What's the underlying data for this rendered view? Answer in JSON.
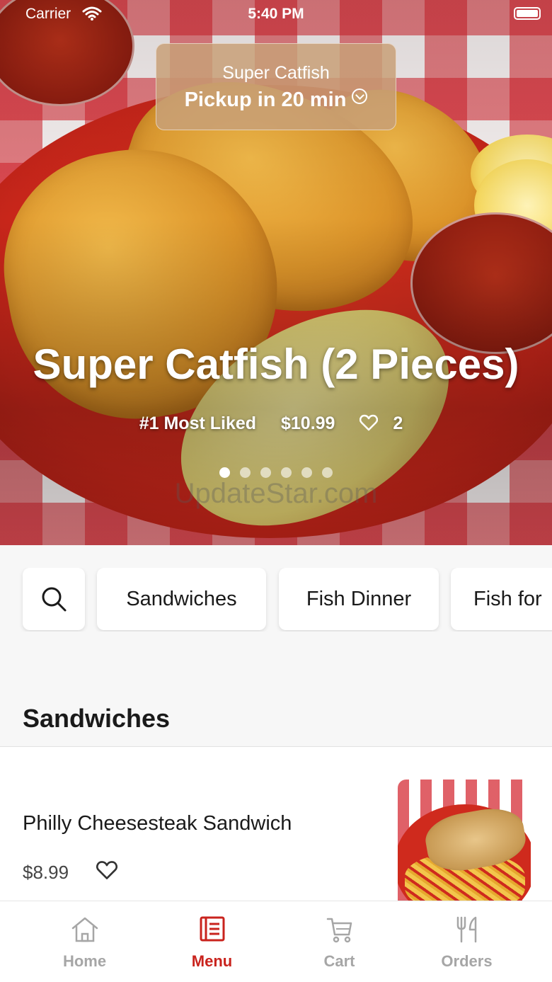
{
  "status_bar": {
    "carrier": "Carrier",
    "time": "5:40 PM"
  },
  "pickup": {
    "store": "Super Catfish",
    "time_text": "Pickup in 20 min"
  },
  "hero": {
    "title": "Super Catfish (2 Pieces)",
    "badge": "#1 Most Liked",
    "price": "$10.99",
    "likes": "2",
    "carousel_pages": 6,
    "carousel_active": 1,
    "watermark": "UpdateStar.com"
  },
  "categories": [
    "Sandwiches",
    "Fish Dinner",
    "Fish for"
  ],
  "section": {
    "title": "Sandwiches"
  },
  "items": [
    {
      "name": "Philly Cheesesteak Sandwich",
      "price": "$8.99"
    }
  ],
  "tabs": [
    {
      "label": "Home",
      "icon": "home-icon",
      "active": false
    },
    {
      "label": "Menu",
      "icon": "menu-icon",
      "active": true
    },
    {
      "label": "Cart",
      "icon": "cart-icon",
      "active": false
    },
    {
      "label": "Orders",
      "icon": "utensils-icon",
      "active": false
    }
  ],
  "colors": {
    "accent": "#c9231d",
    "inactive": "#a6a6a6",
    "background": "#f7f7f7"
  }
}
